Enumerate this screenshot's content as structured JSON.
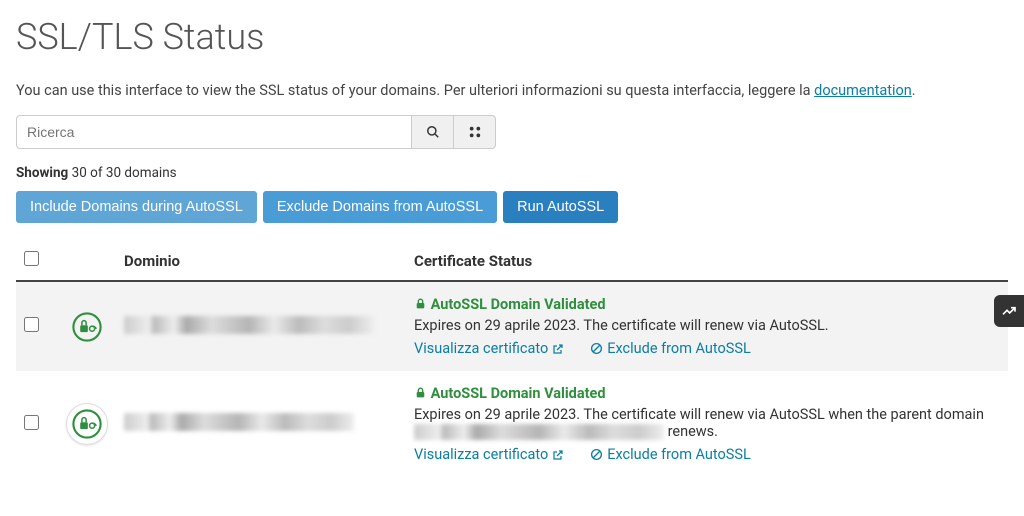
{
  "title": "SSL/TLS Status",
  "intro_part1": "You can use this interface to view the SSL status of your domains. Per ulteriori informazioni su questa interfaccia, leggere la ",
  "intro_link": "documentation",
  "intro_part2": ".",
  "search": {
    "placeholder": "Ricerca"
  },
  "showing": {
    "label": "Showing",
    "text": "30 of 30 domains"
  },
  "buttons": {
    "include": "Include Domains during AutoSSL",
    "exclude": "Exclude Domains from AutoSSL",
    "run": "Run AutoSSL"
  },
  "table": {
    "headers": {
      "domain": "Dominio",
      "status": "Certificate Status"
    },
    "rows": [
      {
        "validated": "AutoSSL Domain Validated",
        "expires": "Expires on 29 aprile 2023. The certificate will renew via AutoSSL.",
        "view_cert": "Visualizza certificato",
        "exclude": "Exclude from AutoSSL"
      },
      {
        "validated": "AutoSSL Domain Validated",
        "expires_pre": "Expires on 29 aprile 2023. The certificate will renew via AutoSSL when the parent domain ",
        "expires_post": " renews.",
        "view_cert": "Visualizza certificato",
        "exclude": "Exclude from AutoSSL"
      }
    ]
  }
}
